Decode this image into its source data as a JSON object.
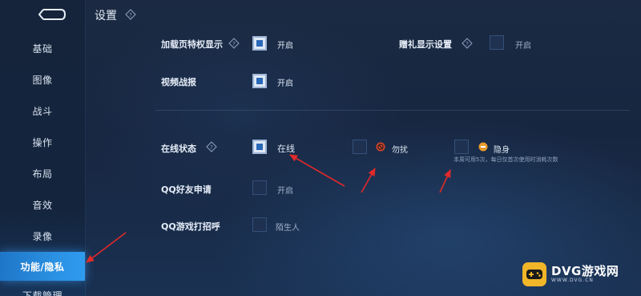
{
  "header": {
    "title": "设置"
  },
  "sidebar": {
    "items": [
      {
        "label": "基础"
      },
      {
        "label": "图像"
      },
      {
        "label": "战斗"
      },
      {
        "label": "操作"
      },
      {
        "label": "布局"
      },
      {
        "label": "音效"
      },
      {
        "label": "录像"
      },
      {
        "label": "功能/隐私"
      },
      {
        "label": "下载管理"
      }
    ],
    "active_index": 7
  },
  "settings": {
    "loading_privilege": {
      "label": "加载页特权显示",
      "checked": true,
      "value": "开启"
    },
    "gift_display": {
      "label": "赠礼显示设置",
      "checked": false,
      "value": "开启"
    },
    "video_report": {
      "label": "视频战报",
      "checked": true,
      "value": "开启"
    },
    "online_status": {
      "label": "在线状态",
      "options": [
        {
          "text": "在线",
          "checked": true
        },
        {
          "text": "勿扰",
          "checked": false
        },
        {
          "text": "隐身",
          "checked": false
        }
      ],
      "note": "本周可用5次，每日仅首次使用时消耗次数"
    },
    "qq_friend_request": {
      "label": "QQ好友申请",
      "checked": false,
      "value": "开启"
    },
    "qq_game_greeting": {
      "label": "QQ游戏打招呼",
      "checked": false,
      "value": "陌生人"
    }
  },
  "watermark": {
    "main": "DVG游戏网",
    "sub": "WWW.DVG.CN"
  },
  "colors": {
    "accent": "#2a8fe0",
    "arrow": "#e02a2a",
    "dnd_icon": "#d8452b",
    "invisible_icon": "#e79a2c",
    "watermark_badge": "#f2b629"
  }
}
